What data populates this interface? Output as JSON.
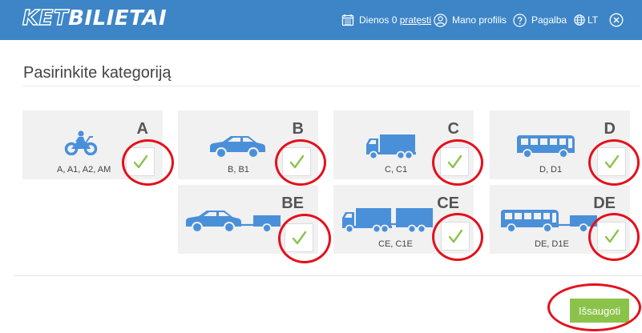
{
  "brand": {
    "logo_part1": "KET",
    "logo_part2": "BILIETAI"
  },
  "nav": {
    "days_prefix": "Dienos 0 ",
    "days_link": "pratęsti",
    "profile": "Mano profilis",
    "help": "Pagalba",
    "language": "LT"
  },
  "page": {
    "title": "Pasirinkite kategoriją"
  },
  "categories": [
    {
      "letter": "A",
      "subtitle": "A, A1, A2, AM",
      "vehicle_icon": "motorcycle-icon",
      "checked": true
    },
    {
      "letter": "B",
      "subtitle": "B, B1",
      "vehicle_icon": "car-icon",
      "checked": true
    },
    {
      "letter": "C",
      "subtitle": "C, C1",
      "vehicle_icon": "truck-icon",
      "checked": true
    },
    {
      "letter": "D",
      "subtitle": "D, D1",
      "vehicle_icon": "bus-icon",
      "checked": true
    },
    {
      "letter": "BE",
      "subtitle": "",
      "vehicle_icon": "car-trailer-icon",
      "checked": true
    },
    {
      "letter": "CE",
      "subtitle": "CE, C1E",
      "vehicle_icon": "truck-trailer-icon",
      "checked": true
    },
    {
      "letter": "DE",
      "subtitle": "DE, D1E",
      "vehicle_icon": "bus-trailer-icon",
      "checked": true
    }
  ],
  "actions": {
    "save_label": "Išsaugoti"
  },
  "colors": {
    "header": "#3d85c6",
    "vehicle_icon": "#4a90d9",
    "check": "#8bc34a",
    "save_button": "#8bc34a",
    "annotation_circle": "#e4101c",
    "card_bg": "#f1f1f1"
  }
}
